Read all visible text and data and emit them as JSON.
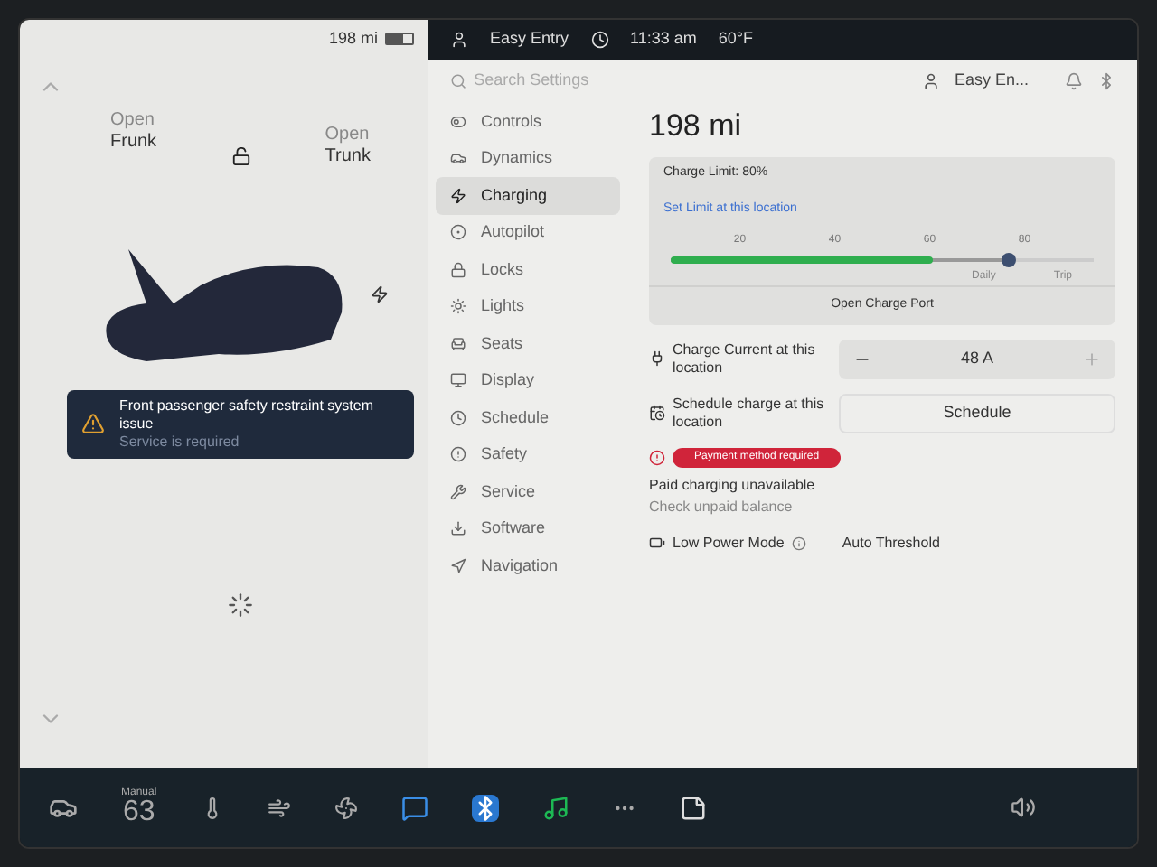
{
  "car_panel": {
    "range": "198 mi",
    "battery": {
      "level": 0.62
    },
    "frunk": {
      "action": "Open",
      "label": "Frunk"
    },
    "trunk": {
      "action": "Open",
      "label": "Trunk"
    },
    "locked": false,
    "alert": {
      "title": "Front passenger safety restraint system issue",
      "subtitle": "Service is required"
    }
  },
  "status_bar": {
    "profile": "Easy Entry",
    "time": "11:33 am",
    "temperature": "60°F"
  },
  "settings": {
    "search": {
      "placeholder": "Search Settings"
    },
    "profile": "Easy En...",
    "menu": [
      {
        "label": "Controls",
        "selected": false
      },
      {
        "label": "Dynamics",
        "selected": false
      },
      {
        "label": "Charging",
        "selected": true
      },
      {
        "label": "Autopilot",
        "selected": false
      },
      {
        "label": "Locks",
        "selected": false
      },
      {
        "label": "Lights",
        "selected": false
      },
      {
        "label": "Seats",
        "selected": false
      },
      {
        "label": "Display",
        "selected": false
      },
      {
        "label": "Schedule",
        "selected": false
      },
      {
        "label": "Safety",
        "selected": false
      },
      {
        "label": "Service",
        "selected": false
      },
      {
        "label": "Software",
        "selected": false
      },
      {
        "label": "Navigation",
        "selected": false
      }
    ]
  },
  "charging": {
    "range": "198 mi",
    "charge_limit": "Charge Limit: 80%",
    "set_limit_link": "Set Limit at this location",
    "slider": {
      "level": 0.8,
      "charged": {
        "level": 0.62
      },
      "ticks": [
        "20",
        "40",
        "60",
        "80"
      ],
      "daily_label": "Daily",
      "trip_label": "Trip"
    },
    "open_port_button": "Open Charge Port",
    "charge_current": {
      "label": "Charge Current at this location",
      "value": "48 A"
    },
    "schedule": {
      "label": "Schedule charge at this location",
      "button": "Schedule"
    },
    "payment": {
      "badge": "Payment method required",
      "title": "Paid charging unavailable",
      "subtitle": "Check unpaid balance"
    },
    "low_power": {
      "label": "Low Power Mode",
      "value": "Auto Threshold"
    }
  },
  "dock": {
    "climate_mode": "Manual",
    "temperature": "63"
  }
}
